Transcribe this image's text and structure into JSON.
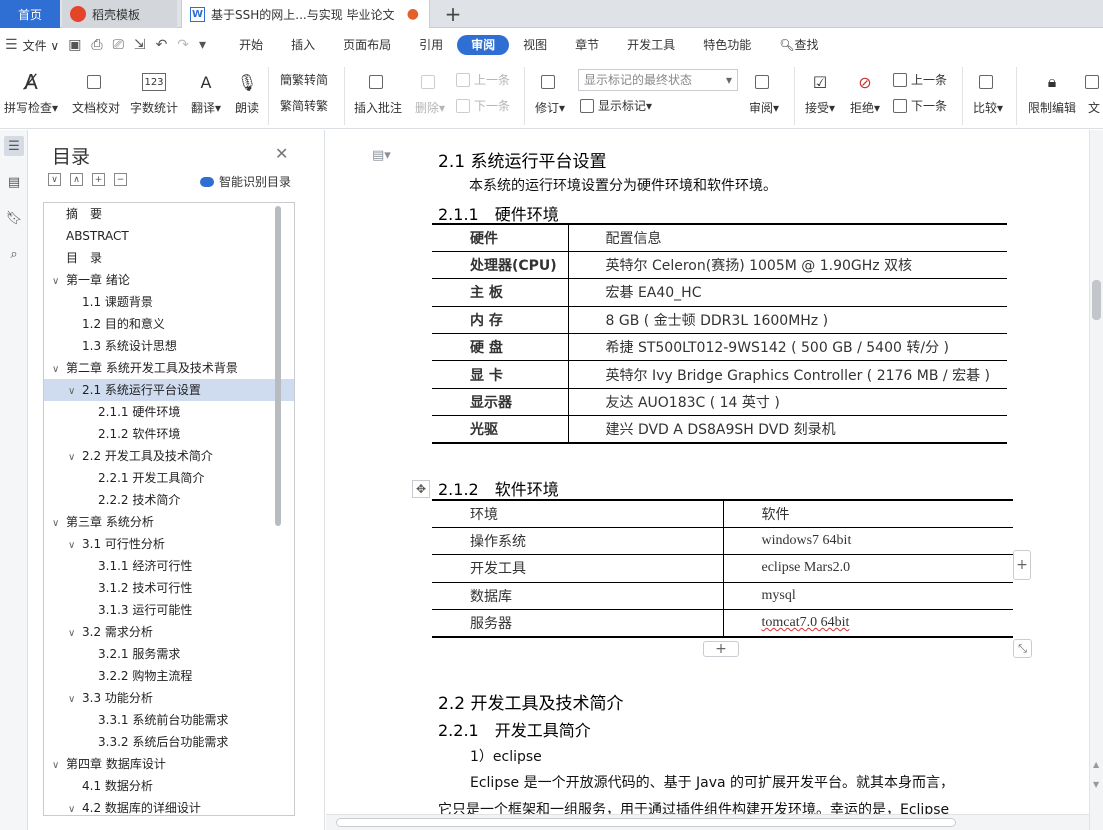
{
  "tabs": {
    "home": "首页",
    "daoke": "稻壳模板",
    "doc": "基于SSH的网上...与实现 毕业论文"
  },
  "menubar": {
    "file": "文件",
    "items": [
      "开始",
      "插入",
      "页面布局",
      "引用",
      "审阅",
      "视图",
      "章节",
      "开发工具",
      "特色功能"
    ],
    "active": "审阅",
    "search": "查找"
  },
  "ribbon": {
    "spellcheck": "拼写检查",
    "proofread": "文档校对",
    "wordcount": "字数统计",
    "translate": "翻译",
    "readaloud": "朗读",
    "to_traditional": "繁转简",
    "to_simplified": "简转繁",
    "insert_comment": "插入批注",
    "delete": "删除",
    "prev_comment": "上一条",
    "next_comment": "下一条",
    "track": "修订",
    "markup_state": "显示标记的最终状态",
    "show_markup": "显示标记",
    "review": "审阅",
    "accept": "接受",
    "reject": "拒绝",
    "prev_change": "上一条",
    "next_change": "下一条",
    "compare": "比较",
    "restrict": "限制编辑",
    "doc_cut": "文"
  },
  "toc": {
    "title": "目录",
    "smart": "智能识别目录",
    "items": [
      {
        "label": "摘　要",
        "level": 0,
        "arrow": ""
      },
      {
        "label": "ABSTRACT",
        "level": 0,
        "arrow": ""
      },
      {
        "label": "目　录",
        "level": 0,
        "arrow": ""
      },
      {
        "label": "第一章  绪论",
        "level": 0,
        "arrow": "∨"
      },
      {
        "label": "1.1  课题背景",
        "level": 1,
        "arrow": ""
      },
      {
        "label": "1.2  目的和意义",
        "level": 1,
        "arrow": ""
      },
      {
        "label": "1.3  系统设计思想",
        "level": 1,
        "arrow": ""
      },
      {
        "label": "第二章  系统开发工具及技术背景",
        "level": 0,
        "arrow": "∨"
      },
      {
        "label": "2.1  系统运行平台设置",
        "level": 1,
        "arrow": "∨",
        "selected": true
      },
      {
        "label": "2.1.1  硬件环境",
        "level": 2,
        "arrow": ""
      },
      {
        "label": "2.1.2  软件环境",
        "level": 2,
        "arrow": ""
      },
      {
        "label": "2.2  开发工具及技术简介",
        "level": 1,
        "arrow": "∨"
      },
      {
        "label": "2.2.1  开发工具简介",
        "level": 2,
        "arrow": ""
      },
      {
        "label": "2.2.2  技术简介",
        "level": 2,
        "arrow": ""
      },
      {
        "label": "第三章  系统分析",
        "level": 0,
        "arrow": "∨"
      },
      {
        "label": "3.1  可行性分析",
        "level": 1,
        "arrow": "∨"
      },
      {
        "label": "3.1.1  经济可行性",
        "level": 2,
        "arrow": ""
      },
      {
        "label": "3.1.2  技术可行性",
        "level": 2,
        "arrow": ""
      },
      {
        "label": "3.1.3  运行可能性",
        "level": 2,
        "arrow": ""
      },
      {
        "label": "3.2  需求分析",
        "level": 1,
        "arrow": "∨"
      },
      {
        "label": "3.2.1  服务需求",
        "level": 2,
        "arrow": ""
      },
      {
        "label": "3.2.2  购物主流程",
        "level": 2,
        "arrow": ""
      },
      {
        "label": "3.3  功能分析",
        "level": 1,
        "arrow": "∨"
      },
      {
        "label": "3.3.1  系统前台功能需求",
        "level": 2,
        "arrow": ""
      },
      {
        "label": "3.3.2  系统后台功能需求",
        "level": 2,
        "arrow": ""
      },
      {
        "label": "第四章  数据库设计",
        "level": 0,
        "arrow": "∨"
      },
      {
        "label": "4.1  数据分析",
        "level": 1,
        "arrow": ""
      },
      {
        "label": "4.2  数据库的详细设计",
        "level": 1,
        "arrow": "∨"
      }
    ]
  },
  "doc": {
    "h_2_1": "2.1  系统运行平台设置",
    "p_2_1": "本系统的运行环境设置分为硬件环境和软件环境。",
    "h_2_1_1": "2.1.1　硬件环境",
    "hw_table": [
      [
        "硬件",
        "配置信息"
      ],
      [
        "处理器(CPU)",
        "英特尔  Celeron(赛扬) 1005M @ 1.90GHz  双核"
      ],
      [
        "主  板",
        "宏碁  EA40_HC"
      ],
      [
        "内  存",
        "8 GB ( 金士顿  DDR3L 1600MHz )"
      ],
      [
        "硬  盘",
        "希捷  ST500LT012-9WS142 ( 500 GB / 5400  转/分  )"
      ],
      [
        "显  卡",
        "英特尔  Ivy Bridge Graphics Controller ( 2176 MB /  宏碁  )"
      ],
      [
        "显示器",
        "友达  AUO183C ( 14  英寸  )"
      ],
      [
        "光驱",
        "建兴  DVD A DS8A9SH DVD 刻录机"
      ]
    ],
    "h_2_1_2": "2.1.2　软件环境",
    "sw_table": [
      [
        "环境",
        "软件"
      ],
      [
        "操作系统",
        "windows7 64bit"
      ],
      [
        "开发工具",
        "eclipse Mars2.0"
      ],
      [
        "数据库",
        "mysql"
      ],
      [
        "服务器",
        "tomcat7.0 64bit"
      ]
    ],
    "h_2_2": "2.2  开发工具及技术简介",
    "h_2_2_1": "2.2.1　开发工具简介",
    "p_eclipse_title": "1）eclipse",
    "p_eclipse_1": "Eclipse  是一个开放源代码的、基于 Java 的可扩展开发平台。就其本身而言，",
    "p_eclipse_2": "它只是一个框架和一组服务，用于通过插件组件构建开发环境。幸运的是，Eclipse"
  }
}
